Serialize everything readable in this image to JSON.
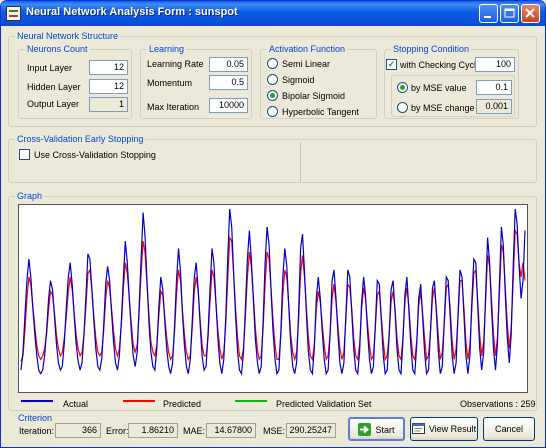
{
  "window": {
    "title": "Neural Network Analysis Form : sunspot"
  },
  "structure": {
    "label": "Neural Network Structure",
    "neurons": {
      "label": "Neurons Count",
      "input_label": "Input Layer",
      "input_value": "12",
      "hidden_label": "Hidden Layer",
      "hidden_value": "12",
      "output_label": "Output Layer",
      "output_value": "1"
    },
    "learning": {
      "label": "Learning",
      "rate_label": "Learning Rate",
      "rate_value": "0.05",
      "momentum_label": "Momentum",
      "momentum_value": "0.5",
      "maxiter_label": "Max Iteration",
      "maxiter_value": "10000"
    },
    "activation": {
      "label": "Activation Function",
      "options": [
        "Semi Linear",
        "Sigmoid",
        "Bipolar Sigmoid",
        "Hyperbolic Tangent"
      ],
      "selected": "Bipolar Sigmoid"
    },
    "stopping": {
      "label": "Stopping Condition",
      "cycle_label": "with Checking Cycle",
      "cycle_checked": true,
      "cycle_value": "100",
      "mse_label": "by MSE value",
      "mse_value": "0.1",
      "msechange_label": "by MSE change",
      "msechange_value": "0.001",
      "selected": "by MSE value"
    }
  },
  "crossval": {
    "label": "Cross-Validation Early Stopping",
    "checkbox_label": "Use Cross-Validation Stopping",
    "checked": false
  },
  "graph": {
    "label": "Graph",
    "legend": {
      "actual": "Actual",
      "predicted": "Predicted",
      "validation": "Predicted Validation Set"
    },
    "observations": "Observations : 259",
    "colors": {
      "actual": "#0000cc",
      "predicted": "#ff0000",
      "validation": "#00c000"
    }
  },
  "chart_data": {
    "type": "line",
    "series": [
      {
        "name": "Actual",
        "values": [
          0.1,
          0.2,
          0.4,
          0.6,
          0.72,
          0.62,
          0.45,
          0.3,
          0.18,
          0.1,
          0.08,
          0.1,
          0.18,
          0.32,
          0.5,
          0.6,
          0.55,
          0.4,
          0.25,
          0.14,
          0.1,
          0.12,
          0.25,
          0.45,
          0.62,
          0.7,
          0.58,
          0.4,
          0.25,
          0.15,
          0.1,
          0.14,
          0.3,
          0.52,
          0.75,
          0.72,
          0.55,
          0.38,
          0.22,
          0.12,
          0.1,
          0.16,
          0.35,
          0.58,
          0.68,
          0.6,
          0.42,
          0.26,
          0.14,
          0.1,
          0.18,
          0.38,
          0.62,
          0.82,
          0.7,
          0.5,
          0.32,
          0.18,
          0.12,
          0.2,
          0.45,
          0.72,
          0.98,
          0.85,
          0.6,
          0.36,
          0.2,
          0.12,
          0.1,
          0.22,
          0.45,
          0.62,
          0.55,
          0.38,
          0.22,
          0.12,
          0.08,
          0.14,
          0.35,
          0.6,
          0.78,
          0.65,
          0.42,
          0.24,
          0.12,
          0.08,
          0.16,
          0.38,
          0.62,
          0.7,
          0.55,
          0.35,
          0.18,
          0.1,
          0.12,
          0.3,
          0.55,
          0.78,
          0.7,
          0.48,
          0.28,
          0.14,
          0.08,
          0.16,
          0.4,
          0.72,
          1.0,
          0.9,
          0.65,
          0.4,
          0.2,
          0.1,
          0.08,
          0.2,
          0.45,
          0.72,
          0.88,
          0.72,
          0.5,
          0.28,
          0.15,
          0.08,
          0.12,
          0.38,
          0.7,
          0.9,
          0.8,
          0.55,
          0.32,
          0.16,
          0.08,
          0.1,
          0.32,
          0.62,
          0.78,
          0.68,
          0.45,
          0.25,
          0.12,
          0.08,
          0.14,
          0.42,
          0.78,
          0.86,
          0.65,
          0.4,
          0.2,
          0.1,
          0.08,
          0.22,
          0.5,
          0.62,
          0.5,
          0.32,
          0.16,
          0.08,
          0.1,
          0.3,
          0.6,
          0.66,
          0.5,
          0.3,
          0.14,
          0.08,
          0.14,
          0.4,
          0.66,
          0.62,
          0.42,
          0.22,
          0.1,
          0.08,
          0.2,
          0.48,
          0.62,
          0.52,
          0.32,
          0.16,
          0.08,
          0.12,
          0.36,
          0.6,
          0.58,
          0.38,
          0.18,
          0.08,
          0.1,
          0.3,
          0.55,
          0.6,
          0.42,
          0.22,
          0.1,
          0.08,
          0.26,
          0.52,
          0.62,
          0.44,
          0.24,
          0.1,
          0.08,
          0.24,
          0.5,
          0.58,
          0.4,
          0.2,
          0.08,
          0.1,
          0.32,
          0.56,
          0.6,
          0.42,
          0.2,
          0.08,
          0.12,
          0.38,
          0.62,
          0.6,
          0.4,
          0.18,
          0.08,
          0.14,
          0.42,
          0.66,
          0.62,
          0.4,
          0.18,
          0.08,
          0.18,
          0.48,
          0.72,
          0.7,
          0.45,
          0.22,
          0.1,
          0.2,
          0.52,
          0.84,
          0.7,
          0.45,
          0.22,
          0.1,
          0.24,
          0.58,
          0.9,
          0.8,
          0.52,
          0.28,
          0.14,
          0.3,
          0.68,
          1.0,
          0.92,
          0.68,
          0.5,
          0.6,
          0.88
        ]
      },
      {
        "name": "Predicted",
        "values": [
          0.15,
          0.18,
          0.32,
          0.5,
          0.62,
          0.58,
          0.46,
          0.34,
          0.24,
          0.18,
          0.16,
          0.18,
          0.22,
          0.3,
          0.44,
          0.54,
          0.52,
          0.42,
          0.3,
          0.22,
          0.18,
          0.2,
          0.28,
          0.4,
          0.54,
          0.62,
          0.55,
          0.42,
          0.3,
          0.22,
          0.18,
          0.2,
          0.3,
          0.46,
          0.64,
          0.66,
          0.55,
          0.4,
          0.28,
          0.2,
          0.18,
          0.2,
          0.32,
          0.5,
          0.6,
          0.56,
          0.44,
          0.32,
          0.22,
          0.18,
          0.22,
          0.36,
          0.56,
          0.7,
          0.64,
          0.5,
          0.36,
          0.24,
          0.2,
          0.24,
          0.42,
          0.64,
          0.82,
          0.76,
          0.58,
          0.4,
          0.26,
          0.2,
          0.18,
          0.24,
          0.4,
          0.54,
          0.52,
          0.4,
          0.28,
          0.2,
          0.16,
          0.18,
          0.32,
          0.52,
          0.66,
          0.6,
          0.44,
          0.3,
          0.2,
          0.16,
          0.18,
          0.34,
          0.54,
          0.62,
          0.54,
          0.38,
          0.24,
          0.18,
          0.18,
          0.28,
          0.48,
          0.66,
          0.62,
          0.48,
          0.32,
          0.22,
          0.16,
          0.2,
          0.36,
          0.6,
          0.84,
          0.82,
          0.64,
          0.44,
          0.28,
          0.18,
          0.16,
          0.22,
          0.4,
          0.62,
          0.76,
          0.68,
          0.52,
          0.34,
          0.22,
          0.16,
          0.18,
          0.34,
          0.58,
          0.76,
          0.72,
          0.56,
          0.38,
          0.24,
          0.16,
          0.16,
          0.3,
          0.52,
          0.66,
          0.62,
          0.46,
          0.3,
          0.2,
          0.16,
          0.2,
          0.38,
          0.64,
          0.74,
          0.62,
          0.44,
          0.28,
          0.18,
          0.16,
          0.24,
          0.44,
          0.54,
          0.48,
          0.36,
          0.24,
          0.16,
          0.18,
          0.3,
          0.5,
          0.58,
          0.48,
          0.34,
          0.22,
          0.16,
          0.2,
          0.38,
          0.58,
          0.56,
          0.44,
          0.28,
          0.18,
          0.16,
          0.24,
          0.44,
          0.56,
          0.5,
          0.36,
          0.24,
          0.16,
          0.18,
          0.34,
          0.52,
          0.54,
          0.4,
          0.26,
          0.16,
          0.18,
          0.3,
          0.48,
          0.54,
          0.44,
          0.28,
          0.18,
          0.16,
          0.28,
          0.48,
          0.56,
          0.46,
          0.3,
          0.18,
          0.16,
          0.26,
          0.46,
          0.54,
          0.42,
          0.28,
          0.16,
          0.18,
          0.32,
          0.5,
          0.56,
          0.44,
          0.28,
          0.16,
          0.2,
          0.36,
          0.56,
          0.58,
          0.44,
          0.26,
          0.16,
          0.22,
          0.4,
          0.6,
          0.6,
          0.44,
          0.26,
          0.16,
          0.24,
          0.44,
          0.64,
          0.66,
          0.48,
          0.3,
          0.18,
          0.26,
          0.48,
          0.74,
          0.68,
          0.5,
          0.3,
          0.18,
          0.28,
          0.52,
          0.8,
          0.76,
          0.56,
          0.36,
          0.22,
          0.34,
          0.6,
          0.88,
          0.86,
          0.7,
          0.62,
          0.7,
          0.6
        ]
      }
    ]
  },
  "criterion": {
    "label": "Criterion",
    "iteration_label": "Iteration:",
    "iteration_value": "366",
    "error_label": "Error:",
    "error_value": "1.86210",
    "mae_label": "MAE:",
    "mae_value": "14.67800",
    "mse_label": "MSE:",
    "mse_value": "290.25247"
  },
  "buttons": {
    "start": "Start",
    "view_result": "View Result",
    "cancel": "Cancel"
  }
}
